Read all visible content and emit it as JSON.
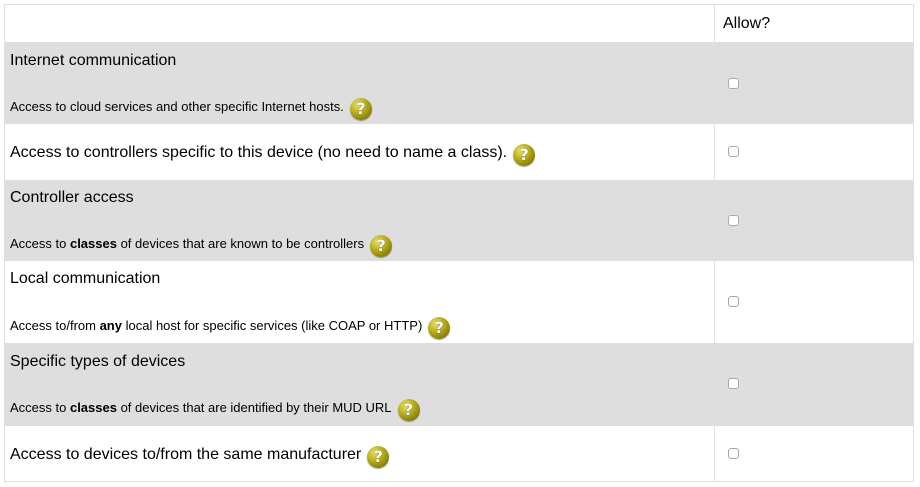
{
  "header": {
    "allow_label": "Allow?"
  },
  "rows": [
    {
      "title": "Internet communication",
      "description_parts": [
        "Access to cloud services and other specific Internet hosts.",
        "",
        ""
      ],
      "checked": false
    },
    {
      "title": "",
      "description_parts": [
        "Access to controllers specific to this device (no need to name a class).",
        "",
        ""
      ],
      "checked": false
    },
    {
      "title": "Controller access",
      "description_parts": [
        "Access to ",
        "classes",
        " of devices that are known to be controllers"
      ],
      "checked": false
    },
    {
      "title": "Local communication",
      "description_parts": [
        "Access to/from ",
        "any",
        " local host for specific services (like COAP or HTTP)"
      ],
      "checked": false
    },
    {
      "title": "Specific types of devices",
      "description_parts": [
        "Access to ",
        "classes",
        " of devices that are identified by their MUD URL"
      ],
      "checked": false
    },
    {
      "title": "",
      "description_parts": [
        "Access to devices to/from the same manufacturer",
        "",
        ""
      ],
      "checked": false
    }
  ],
  "help_icon": {
    "glyph": "?",
    "color": "#b9ae1a"
  }
}
